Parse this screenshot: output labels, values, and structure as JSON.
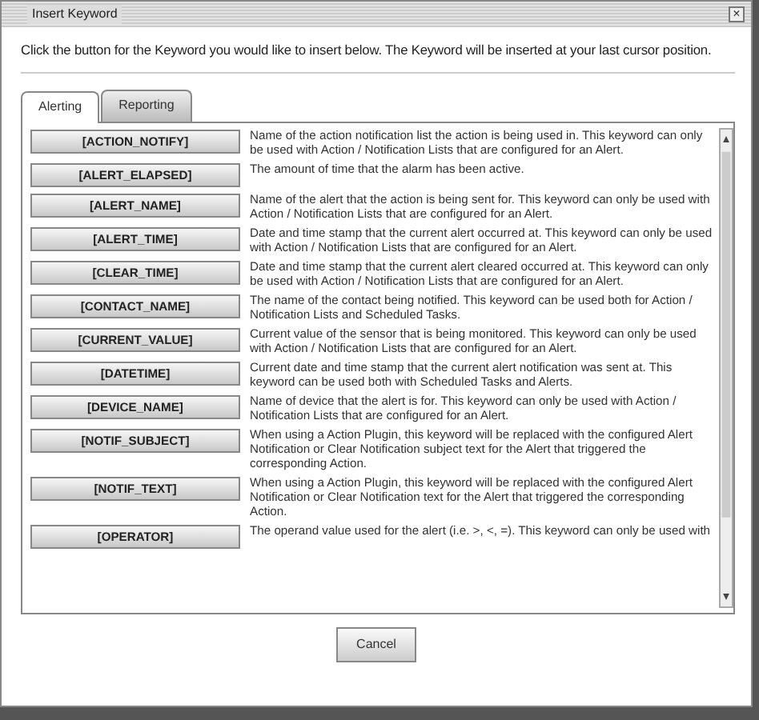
{
  "window": {
    "title": "Insert Keyword",
    "close": "×"
  },
  "instruction": "Click the button for the Keyword you would like to insert below. The Keyword will be inserted at your last cursor position.",
  "tabs": [
    {
      "label": "Alerting",
      "selected": true
    },
    {
      "label": "Reporting",
      "selected": false
    }
  ],
  "keywords": [
    {
      "button": "[ACTION_NOTIFY]",
      "description": "Name of the action notification list the action is being used in. This keyword can only be used with Action / Notification Lists that are configured for an Alert."
    },
    {
      "button": "[ALERT_ELAPSED]",
      "description": "The amount of time that the alarm has been active."
    },
    {
      "button": "[ALERT_NAME]",
      "description": "Name of the alert that the action is being sent for. This keyword can only be used with Action / Notification Lists that are configured for an Alert."
    },
    {
      "button": "[ALERT_TIME]",
      "description": "Date and time stamp that the current alert occurred at. This keyword can only be used with Action / Notification Lists that are configured for an Alert."
    },
    {
      "button": "[CLEAR_TIME]",
      "description": "Date and time stamp that the current alert cleared occurred at. This keyword can only be used with Action / Notification Lists that are configured for an Alert."
    },
    {
      "button": "[CONTACT_NAME]",
      "description": "The name of the contact being notified. This keyword can be used both for Action / Notification Lists and Scheduled Tasks."
    },
    {
      "button": "[CURRENT_VALUE]",
      "description": "Current value of the sensor that is being monitored. This keyword can only be used with Action / Notification Lists that are configured for an Alert."
    },
    {
      "button": "[DATETIME]",
      "description": "Current date and time stamp that the current alert notification was sent at. This keyword can be used both with Scheduled Tasks and Alerts."
    },
    {
      "button": "[DEVICE_NAME]",
      "description": "Name of device that the alert is for. This keyword can only be used with Action / Notification Lists that are configured for an Alert."
    },
    {
      "button": "[NOTIF_SUBJECT]",
      "description": "When using a Action Plugin, this keyword will be replaced with the configured Alert Notification or Clear Notification subject text for the Alert that triggered the corresponding Action."
    },
    {
      "button": "[NOTIF_TEXT]",
      "description": "When using a Action Plugin, this keyword will be replaced with the configured Alert Notification or Clear Notification text for the Alert that triggered the corresponding Action."
    },
    {
      "button": "[OPERATOR]",
      "description": "The operand value used for the alert (i.e. >, <, =). This keyword can only be used with"
    }
  ],
  "buttons": [
    "Cancel"
  ]
}
